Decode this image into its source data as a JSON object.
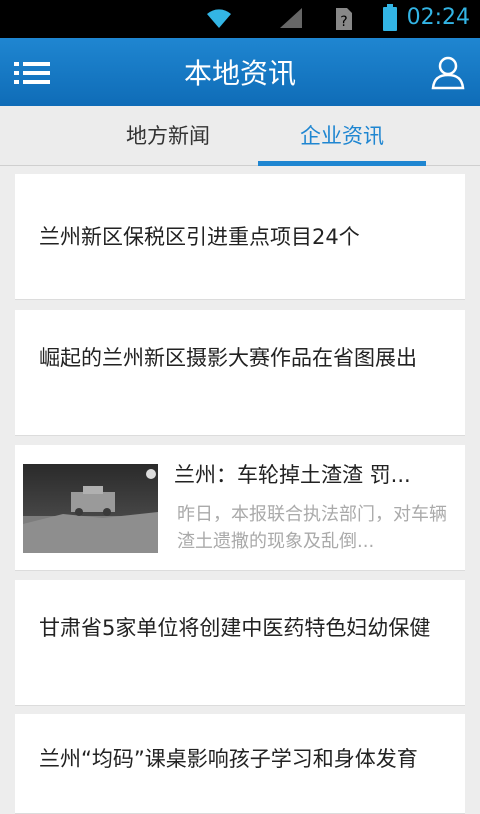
{
  "status_bar": {
    "time": "02:24"
  },
  "header": {
    "title": "本地资讯"
  },
  "tabs": [
    {
      "label": "地方新闻",
      "active": false
    },
    {
      "label": "企业资讯",
      "active": true
    }
  ],
  "news": [
    {
      "headline": "兰州新区保税区引进重点项目24个"
    },
    {
      "headline": "崛起的兰州新区摄影大赛作品在省图展出"
    },
    {
      "headline": "兰州：车轮掉土渣渣 罚...",
      "summary": "昨日，本报联合执法部门，对车辆渣土遗撒的现象及乱倒...",
      "thumbnail": "night-street-photo"
    },
    {
      "headline": "甘肃省5家单位将创建中医药特色妇幼保健"
    },
    {
      "headline": "兰州“均码”课桌影响孩子学习和身体发育"
    }
  ],
  "colors": {
    "accent": "#1f86d1",
    "status_accent": "#33b5e5"
  }
}
